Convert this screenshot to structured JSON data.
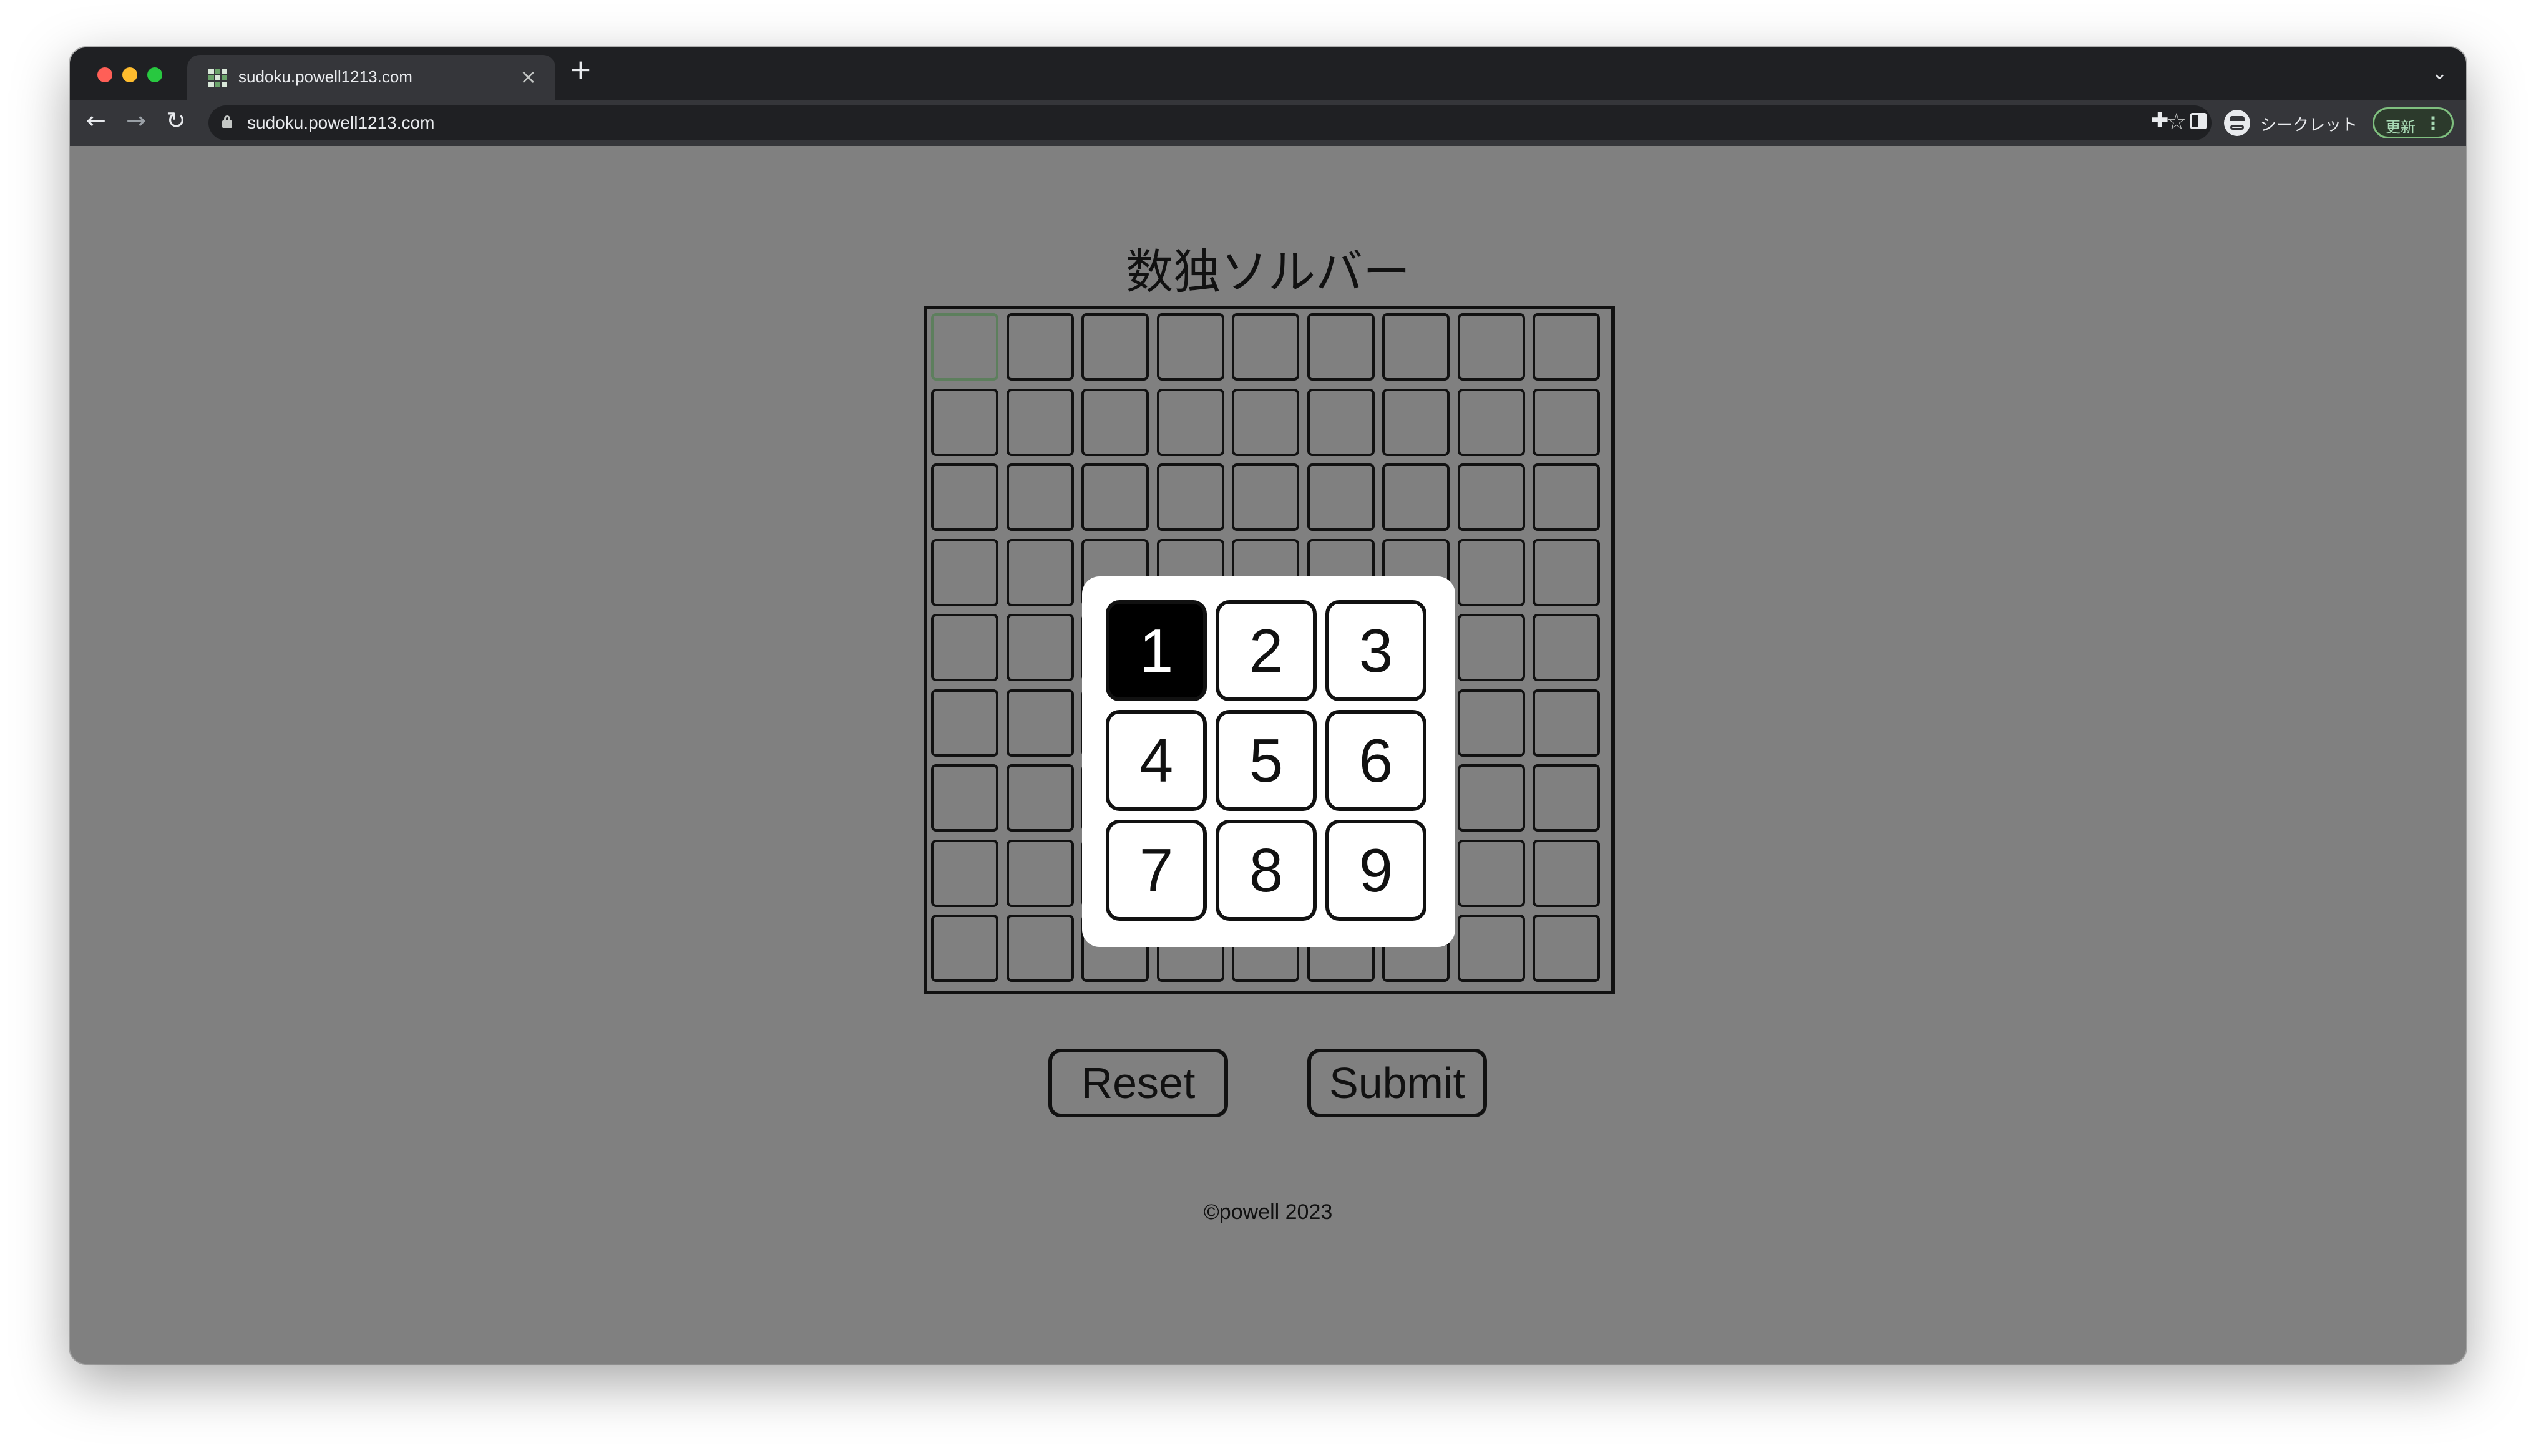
{
  "browser": {
    "tab_title": "sudoku.powell1213.com",
    "url": "sudoku.powell1213.com",
    "incognito_label": "シークレット",
    "update_label": "更新",
    "icons": [
      "back-arrow-icon",
      "forward-arrow-icon",
      "reload-icon",
      "lock-icon",
      "star-icon",
      "extensions-icon",
      "side-panel-icon",
      "incognito-icon",
      "kebab-menu-icon",
      "close-icon",
      "plus-icon",
      "chevron-down-icon"
    ]
  },
  "page": {
    "title": "数独ソルバー",
    "footer": "©powell 2023"
  },
  "board": {
    "rows": 9,
    "cols": 9,
    "selected_cell": [
      0,
      0
    ],
    "values": [
      [
        "",
        "",
        "",
        "",
        "",
        "",
        "",
        "",
        ""
      ],
      [
        "",
        "",
        "",
        "",
        "",
        "",
        "",
        "",
        ""
      ],
      [
        "",
        "",
        "",
        "",
        "",
        "",
        "",
        "",
        ""
      ],
      [
        "",
        "",
        "",
        "",
        "",
        "",
        "",
        "",
        ""
      ],
      [
        "",
        "",
        "",
        "",
        "",
        "",
        "",
        "",
        ""
      ],
      [
        "",
        "",
        "",
        "",
        "",
        "",
        "",
        "",
        ""
      ],
      [
        "",
        "",
        "",
        "",
        "",
        "",
        "",
        "",
        ""
      ],
      [
        "",
        "",
        "",
        "",
        "",
        "",
        "",
        "",
        ""
      ],
      [
        "",
        "",
        "",
        "",
        "",
        "",
        "",
        "",
        ""
      ]
    ]
  },
  "picker": {
    "numbers": [
      "1",
      "2",
      "3",
      "4",
      "5",
      "6",
      "7",
      "8",
      "9"
    ],
    "active": "1"
  },
  "actions": {
    "reset_label": "Reset",
    "submit_label": "Submit"
  }
}
